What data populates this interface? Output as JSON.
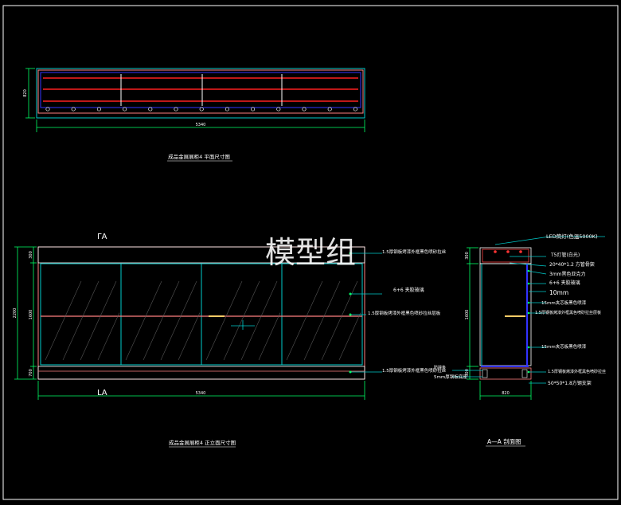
{
  "watermark": "模型组",
  "plan_view": {
    "title": "成品金展展柜4 平面尺寸图",
    "width_dim": "5340",
    "depth_dim": "820"
  },
  "elevation_view": {
    "title": "成品金展展柜4 正立面尺寸图",
    "section_mark_top": "ΓA",
    "section_mark_bottom": "LA",
    "width_dim": "5340",
    "height_total": "2200",
    "height_top": "300",
    "height_middle": "1600",
    "height_bottom": "700",
    "callouts": [
      "1.5厚钢板烤漆外框黑色喷砂拉丝",
      "6+6 夹胶玻璃",
      "1.5厚钢板烤漆外框黑色喷砂拉丝层板",
      "1.5厚钢板烤漆外框黑色喷砂拉丝"
    ]
  },
  "section_view": {
    "title": "A—A  剖面图",
    "width_dim": "820",
    "height_dim": "1600",
    "height_top": "300",
    "height_bottom": "300",
    "callouts_right": [
      "LED筒灯(色温5000K)",
      "T5灯管(白光)",
      "20*40*1.2 方管骨架",
      "3mm黑色亚克力",
      "6+6 夹胶玻璃",
      "10mm",
      "15mm夹芯板黑色喷漆",
      "1.5厚钢板烤漆外框黑色喷砂拉丝层板",
      "15mm夹芯板黑色喷漆",
      "1.5厚钢板烤漆外框黑色喷砂拉丝",
      "50*50*1.8方钢支架"
    ],
    "callouts_left": [
      "防撞条",
      "5mm厚钢板底座"
    ]
  },
  "colors": {
    "background": "#000000",
    "frame": "#ffffff",
    "dimension": "#00ff66",
    "glass": "#00cccc",
    "cabinet": "#ff8080",
    "shelf": "#ff0000",
    "structure": "#0000ff"
  }
}
